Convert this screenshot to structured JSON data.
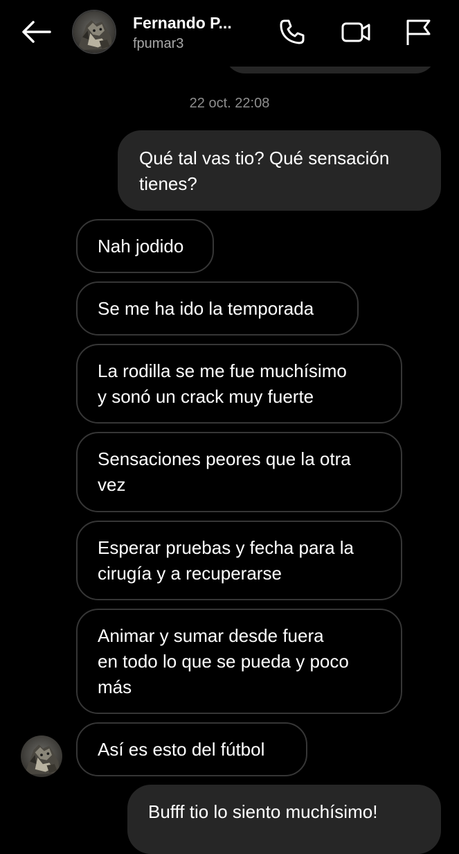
{
  "header": {
    "name": "Fernando P...",
    "username": "fpumar3",
    "back_icon": "arrow-left-icon",
    "call_icon": "phone-icon",
    "video_icon": "video-camera-icon",
    "report_icon": "flag-icon",
    "avatar": "profile-avatar"
  },
  "conversation": {
    "timestamp": "22 oct. 22:08",
    "messages": [
      {
        "sender": "me",
        "lines": [
          "Qué tal vas tio? Qué sensación",
          "tienes?"
        ]
      },
      {
        "sender": "them",
        "lines": [
          "Nah jodido"
        ]
      },
      {
        "sender": "them",
        "lines": [
          "Se me ha ido la temporada"
        ]
      },
      {
        "sender": "them",
        "lines": [
          "La rodilla se me fue muchísimo",
          "y sonó un crack muy fuerte"
        ]
      },
      {
        "sender": "them",
        "lines": [
          "Sensaciones peores que la otra",
          "vez"
        ]
      },
      {
        "sender": "them",
        "lines": [
          "Esperar pruebas y fecha para la",
          "cirugía y a recuperarse"
        ]
      },
      {
        "sender": "them",
        "lines": [
          "Animar y sumar desde fuera",
          "en todo lo que se pueda y poco",
          "más"
        ]
      },
      {
        "sender": "them",
        "lines": [
          "Así es esto del fútbol"
        ]
      },
      {
        "sender": "me",
        "lines": [
          "Bufff tio lo siento muchísimo!"
        ]
      }
    ]
  },
  "colors": {
    "background": "#000000",
    "outgoing_bubble": "#262626",
    "incoming_border": "#363636",
    "secondary_text": "#a8a8a8"
  }
}
